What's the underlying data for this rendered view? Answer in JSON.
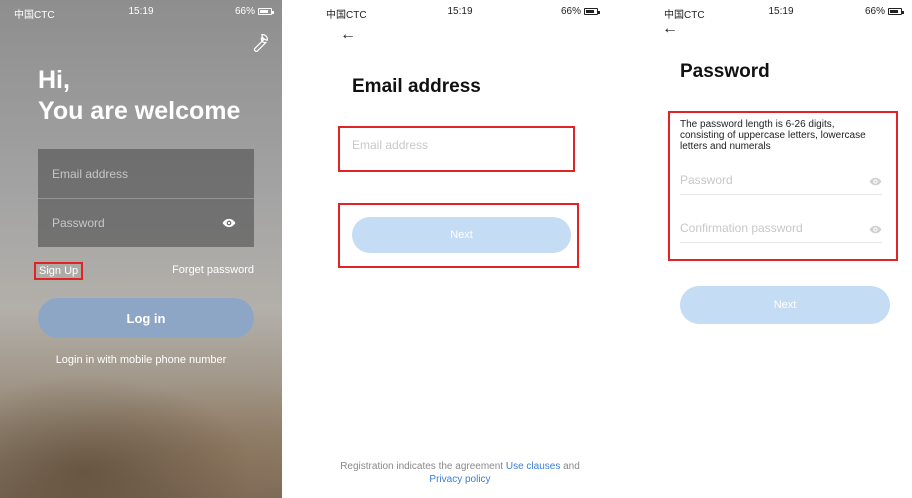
{
  "screen1": {
    "status": {
      "carrier": "中国CTC",
      "time": "15:19",
      "battery": "66%"
    },
    "greeting_line1": "Hi,",
    "greeting_line2": "You are welcome",
    "email_placeholder": "Email address",
    "password_placeholder": "Password",
    "sign_up": "Sign Up",
    "forget_password": "Forget password",
    "login_button": "Log in",
    "mobile_login": "Login in with mobile phone number"
  },
  "screen2": {
    "status": {
      "carrier": "中国CTC",
      "time": "15:19",
      "battery": "66%"
    },
    "title": "Email address",
    "email_placeholder": "Email address",
    "next_button": "Next",
    "agreement_prefix": "Registration indicates the agreement",
    "use_clauses": "Use clauses",
    "and": "and",
    "privacy_policy": "Privacy policy"
  },
  "screen3": {
    "status": {
      "carrier": "中国CTC",
      "time": "15:19",
      "battery": "66%"
    },
    "title": "Password",
    "hint": "The password length is 6-26 digits, consisting of uppercase letters, lowercase letters and numerals",
    "password_placeholder": "Password",
    "confirm_placeholder": "Confirmation password",
    "next_button": "Next"
  },
  "colors": {
    "highlight": "#e02424",
    "link": "#3b7fd6",
    "button_disabled": "#c5dcf5",
    "login_button": "#8ea6c6"
  }
}
